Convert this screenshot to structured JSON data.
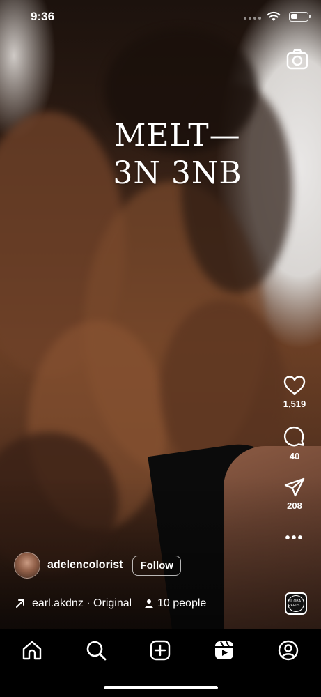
{
  "status_bar": {
    "time": "9:36",
    "battery_level": 0.45
  },
  "overlay": {
    "line1": "MELT—",
    "line2": "3N 3NB"
  },
  "actions": {
    "likes": "1,519",
    "comments": "40",
    "shares": "208"
  },
  "creator": {
    "username": "adelencolorist",
    "follow_label": "Follow"
  },
  "meta": {
    "audio": "earl.akdnz · Original audio",
    "people": "10 people"
  },
  "audio_thumb_label": "SILOBA REELS",
  "icons": {
    "camera": "camera-icon",
    "like": "heart-icon",
    "comment": "comment-icon",
    "share": "send-icon",
    "more": "more-icon",
    "home": "home-icon",
    "search": "search-icon",
    "create": "plus-square-icon",
    "reels": "reels-icon",
    "profile": "profile-icon"
  }
}
